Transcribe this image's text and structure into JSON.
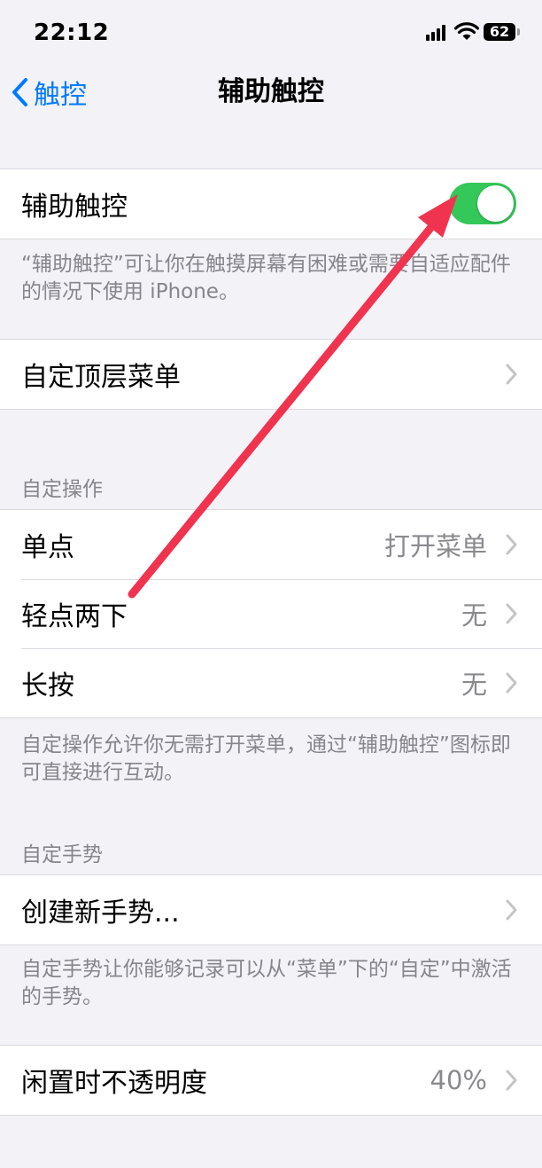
{
  "status": {
    "time": "22:12",
    "battery": "62"
  },
  "nav": {
    "back_label": "触控",
    "title": "辅助触控"
  },
  "assistive_touch": {
    "label": "辅助触控",
    "enabled": true,
    "note": "“辅助触控”可让你在触摸屏幕有困难或需要自适应配件的情况下使用 iPhone。"
  },
  "customize_top_menu": {
    "label": "自定顶层菜单"
  },
  "custom_actions": {
    "header": "自定操作",
    "rows": [
      {
        "label": "单点",
        "value": "打开菜单"
      },
      {
        "label": "轻点两下",
        "value": "无"
      },
      {
        "label": "长按",
        "value": "无"
      }
    ],
    "note": "自定操作允许你无需打开菜单，通过“辅助触控”图标即可直接进行互动。"
  },
  "custom_gestures": {
    "header": "自定手势",
    "create_label": "创建新手势...",
    "note": "自定手势让你能够记录可以从“菜单”下的“自定”中激活的手势。"
  },
  "idle_opacity": {
    "label": "闲置时不透明度",
    "value": "40%"
  },
  "colors": {
    "accent": "#007aff",
    "toggle_on": "#34c759",
    "annotation_arrow": "#f0344f"
  },
  "annotation": {
    "type": "arrow",
    "target": "assistive-touch-toggle"
  }
}
